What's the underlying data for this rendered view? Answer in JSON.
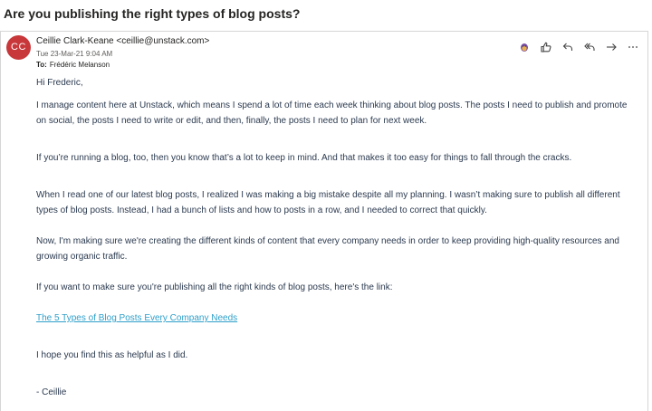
{
  "email": {
    "subject": "Are you publishing the right types of blog posts?",
    "avatar_initials": "CC",
    "avatar_color": "#c8373a",
    "sender": "Ceillie Clark-Keane <ceillie@unstack.com>",
    "date": "Tue 23-Mar-21 9:04 AM",
    "to_label": "To:",
    "to_value": "Frédéric Melanson",
    "actions": [
      "emoji-icon",
      "like-icon",
      "reply-icon",
      "reply-all-icon",
      "forward-icon",
      "more-icon"
    ],
    "body": {
      "greeting": "Hi Frederic,",
      "paragraphs": [
        "I manage content here at Unstack, which means I spend a lot of time each week thinking about blog posts. The posts I need to publish and promote on social, the posts I need to write or edit, and then, finally, the posts I need to plan for next week.",
        "If you’re running a blog, too, then you know that’s a lot to keep in mind. And that makes it too easy for things to fall through the cracks.",
        "When I read one of our latest blog posts, I realized I was making a big mistake despite all my planning. I wasn’t making sure to publish all different types of blog posts. Instead, I had a bunch of lists and how to posts in a row, and I needed to correct that quickly.",
        "Now, I'm making sure we're creating the different kinds of content that every company needs in order to keep providing high-quality resources and growing organic traffic.",
        "If you want to make sure you're publishing all the right kinds of blog posts, here's the link:"
      ],
      "link_text": "The 5 Types of Blog Posts Every Company Needs",
      "closing": "I hope you find this as helpful as I did.",
      "signature": "- Ceillie"
    }
  }
}
